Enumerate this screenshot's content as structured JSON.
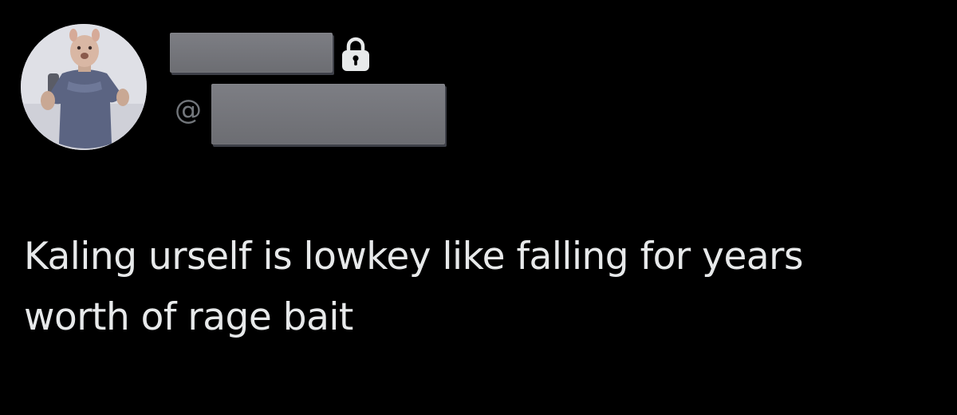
{
  "tweet": {
    "handle_prefix": "@",
    "text": "Kaling urself is lowkey like falling for years worth of rage bait"
  },
  "icons": {
    "avatar": "profile-photo",
    "protected": "lock-icon"
  },
  "colors": {
    "background": "#000000",
    "text": "#e7e9ea",
    "secondary_text": "#72767b",
    "redaction": "#6c6d72"
  }
}
